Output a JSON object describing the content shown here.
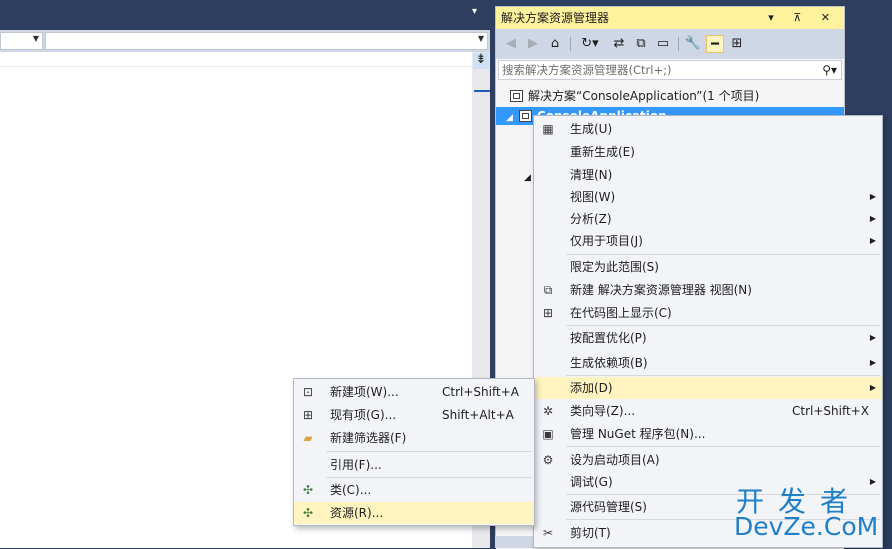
{
  "solution_explorer": {
    "title": "解决方案资源管理器",
    "title_controls": "▾ ⊼ ✕",
    "search_placeholder": "搜索解决方案资源管理器(Ctrl+;)",
    "solution_label": "解决方案“ConsoleApplication”(1 个项目)",
    "project_label": "ConsoleApplication"
  },
  "context_menu": {
    "items": [
      {
        "label": "生成(U)",
        "icon": "build-icon"
      },
      {
        "label": "重新生成(E)"
      },
      {
        "label": "清理(N)"
      },
      {
        "label": "视图(W)",
        "submenu": true
      },
      {
        "label": "分析(Z)",
        "submenu": true
      },
      {
        "label": "仅用于项目(J)",
        "submenu": true
      },
      {
        "label": "限定为此范围(S)"
      },
      {
        "label": "新建 解决方案资源管理器 视图(N)",
        "icon": "new-view-icon"
      },
      {
        "label": "在代码图上显示(C)",
        "icon": "code-map-icon"
      },
      {
        "label": "按配置优化(P)",
        "submenu": true
      },
      {
        "label": "生成依赖项(B)",
        "submenu": true
      },
      {
        "label": "添加(D)",
        "submenu": true,
        "highlighted": true
      },
      {
        "label": "类向导(Z)...",
        "shortcut": "Ctrl+Shift+X",
        "icon": "class-wizard-icon"
      },
      {
        "label": "管理 NuGet 程序包(N)...",
        "icon": "nuget-icon"
      },
      {
        "label": "设为启动项目(A)",
        "icon": "gear-icon"
      },
      {
        "label": "调试(G)",
        "submenu": true
      },
      {
        "label": "源代码管理(S)"
      },
      {
        "label": "剪切(T)",
        "icon": "scissors-icon"
      }
    ]
  },
  "add_submenu": {
    "items": [
      {
        "label": "新建项(W)...",
        "shortcut": "Ctrl+Shift+A",
        "icon": "new-item-icon"
      },
      {
        "label": "现有项(G)...",
        "shortcut": "Shift+Alt+A",
        "icon": "existing-item-icon"
      },
      {
        "label": "新建筛选器(F)",
        "icon": "folder-icon"
      },
      {
        "label": "引用(F)..."
      },
      {
        "label": "类(C)...",
        "icon": "class-icon"
      },
      {
        "label": "资源(R)...",
        "icon": "resource-icon",
        "highlighted": true
      }
    ]
  },
  "watermark": {
    "cn": "开发者",
    "en": "DevZe.CoM"
  },
  "colors": {
    "title_bar": "#fff29d",
    "highlight": "#fff3bf",
    "selection": "#3399ff",
    "ide_background": "#2d3e5e"
  }
}
